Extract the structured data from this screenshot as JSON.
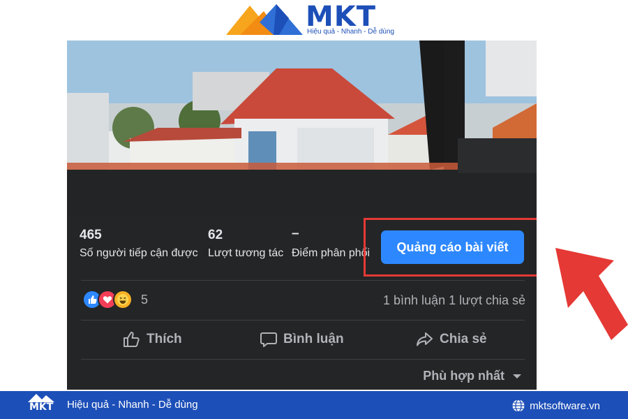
{
  "brand": {
    "name": "MKT",
    "tagline": "Hiệu quả - Nhanh - Dễ dùng"
  },
  "post": {
    "stats": [
      {
        "value": "465",
        "label": "Số người tiếp cận được"
      },
      {
        "value": "62",
        "label": "Lượt tương tác"
      },
      {
        "value": "–",
        "label": "Điểm phân phối"
      }
    ],
    "promote_label": "Quảng cáo bài viết",
    "reactions": {
      "icons": [
        "like-icon",
        "love-icon",
        "haha-icon"
      ],
      "count": "5"
    },
    "comments_text": "1 bình luận",
    "shares_text": "1 lượt chia sẻ",
    "actions": {
      "like": "Thích",
      "comment": "Bình luận",
      "share": "Chia sẻ"
    },
    "sort_label": "Phù hợp nhất"
  },
  "footer": {
    "logo": "MKT",
    "tagline": "Hiệu quả - Nhanh - Dễ dùng",
    "website": "mktsoftware.vn"
  },
  "colors": {
    "card_bg": "#242526",
    "button_blue": "#2d88ff",
    "highlight_red": "#e53935",
    "brand_blue": "#1d4fb8"
  }
}
